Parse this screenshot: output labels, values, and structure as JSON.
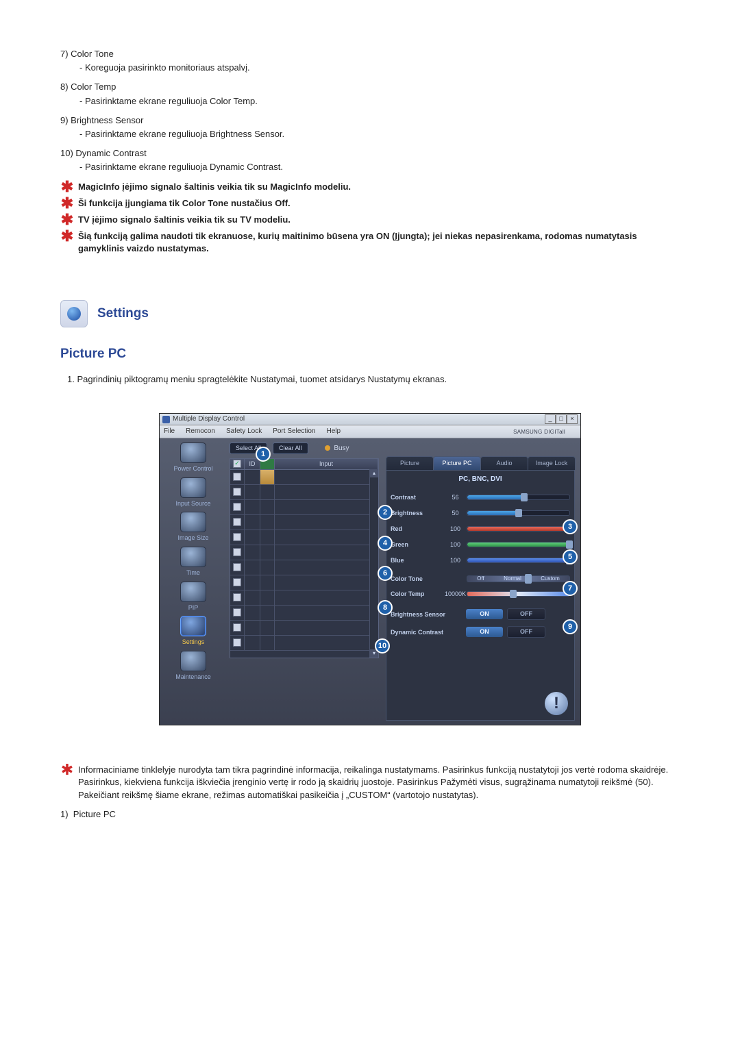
{
  "items_top": [
    {
      "num": "7)",
      "title": "Color Tone",
      "desc": "- Koreguoja pasirinkto monitoriaus atspalvį."
    },
    {
      "num": "8)",
      "title": "Color Temp",
      "desc": "- Pasirinktame ekrane reguliuoja Color Temp."
    },
    {
      "num": "9)",
      "title": "Brightness Sensor",
      "desc": "- Pasirinktame ekrane reguliuoja Brightness Sensor."
    },
    {
      "num": "10)",
      "title": "Dynamic Contrast",
      "desc": "- Pasirinktame ekrane reguliuoja Dynamic Contrast."
    }
  ],
  "notes_bold": [
    "MagicInfo įėjimo signalo šaltinis veikia tik su MagicInfo modeliu.",
    "Ši funkcija įjungiama tik Color Tone nustačius Off.",
    "TV įėjimo signalo šaltinis veikia tik su TV modeliu.",
    "Šią funkciją galima naudoti tik ekranuose, kurių maitinimo būsena yra ON (Įjungta); jei niekas nepasirenkama, rodomas numatytasis gamyklinis vaizdo nustatymas."
  ],
  "settings_header": "Settings",
  "subsection_title": "Picture PC",
  "intro_step_num": "1.",
  "intro_step_text": "Pagrindinių piktogramų meniu spragtelėkite Nustatymai, tuomet atsidarys Nustatymų ekranas.",
  "window": {
    "title": "Multiple Display Control",
    "menu": [
      "File",
      "Remocon",
      "Safety Lock",
      "Port Selection",
      "Help"
    ],
    "logo": "SAMSUNG DIGITall",
    "sidebar": [
      {
        "label": "Power Control"
      },
      {
        "label": "Input Source"
      },
      {
        "label": "Image Size"
      },
      {
        "label": "Time"
      },
      {
        "label": "PIP"
      },
      {
        "label": "Settings",
        "active": true
      },
      {
        "label": "Maintenance"
      }
    ],
    "select_all": "Select All",
    "clear_all": "Clear All",
    "busy": "Busy",
    "grid_headers": {
      "id": "ID",
      "input": "Input"
    },
    "tabs": [
      "Picture",
      "Picture PC",
      "Audio",
      "Image Lock"
    ],
    "active_tab": 1,
    "panel_subtitle": "PC, BNC, DVI",
    "controls": {
      "contrast": {
        "label": "Contrast",
        "value": "56"
      },
      "brightness": {
        "label": "Brightness",
        "value": "50"
      },
      "red": {
        "label": "Red",
        "value": "100"
      },
      "green": {
        "label": "Green",
        "value": "100"
      },
      "blue": {
        "label": "Blue",
        "value": "100"
      },
      "color_tone": {
        "label": "Color Tone",
        "opts": [
          "Off",
          "Normal",
          "Custom"
        ]
      },
      "color_temp": {
        "label": "Color Temp",
        "value": "10000K"
      },
      "brightness_sensor": {
        "label": "Brightness Sensor",
        "on": "ON",
        "off": "OFF"
      },
      "dynamic_contrast": {
        "label": "Dynamic Contrast",
        "on": "ON",
        "off": "OFF"
      }
    },
    "callouts": [
      "1",
      "2",
      "3",
      "4",
      "5",
      "6",
      "7",
      "8",
      "9",
      "10"
    ]
  },
  "bottom_note": "Informaciniame tinklelyje nurodyta tam tikra pagrindinė informacija, reikalinga nustatymams. Pasirinkus funkciją nustatytoji jos vertė rodoma skaidrėje. Pasirinkus, kiekviena funkcija iškviečia įrenginio vertę ir rodo ją skaidrių juostoje. Pasirinkus Pažymėti visus, sugrąžinama numatytoji reikšmė (50). Pakeičiant reikšmę šiame ekrane, režimas automatiškai pasikeičia į „CUSTOM“ (vartotojo nustatytas).",
  "bottom_item": {
    "num": "1)",
    "title": "Picture PC"
  }
}
